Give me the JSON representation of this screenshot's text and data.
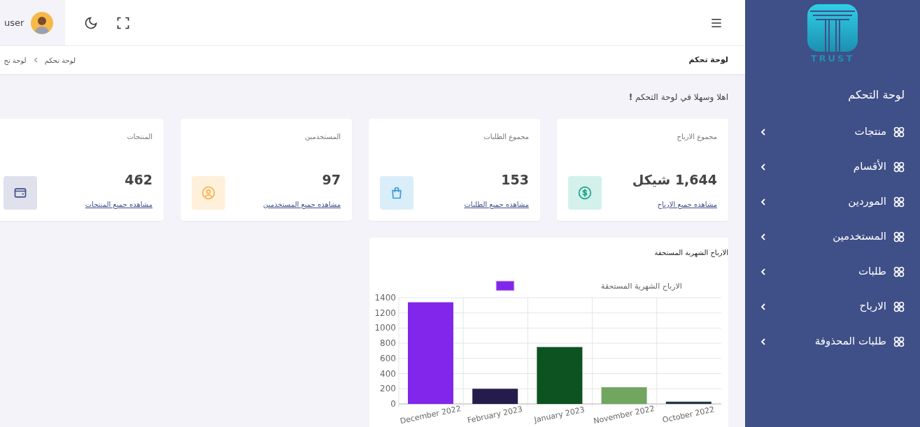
{
  "header": {
    "user_name": "user"
  },
  "breadcrumb": {
    "page_title": "لوحة تحكم",
    "trail": [
      "لوحة تحكم",
      "لوحة تح"
    ]
  },
  "welcome": "اهلا وسهلا في لوحة التحكم **!**",
  "cards": [
    {
      "kind": "money",
      "title": "مجموع الارباح",
      "value": "1,644 شيكل",
      "link": "مشاهده جميع الارباح"
    },
    {
      "kind": "bag",
      "title": "مجموع الطلبات",
      "value": "153",
      "link": "مشاهده جميع الطلبات"
    },
    {
      "kind": "user",
      "title": "المستخدمين",
      "value": "97",
      "link": "مشاهده جميع المستخدمين"
    },
    {
      "kind": "wallet",
      "title": "المنتجات",
      "value": "462",
      "link": "مشاهده جميع المنتجات"
    }
  ],
  "chart_card": {
    "title": "الارباح الشهرية المستحقة",
    "chart_data": {
      "type": "bar",
      "categories": [
        "December 2022",
        "February 2023",
        "January 2023",
        "November 2022",
        "October 2022"
      ],
      "series": [
        {
          "name": "الارباح الشهرية المستحقة",
          "color": "#8226ec",
          "colors": [
            "#8226ec",
            "#261c4c",
            "#0d5221",
            "#71a660",
            "#1f3a4a"
          ],
          "values": [
            1340,
            200,
            750,
            220,
            30
          ]
        }
      ],
      "ylim": [
        0,
        1400
      ],
      "grid": true,
      "yticks": [
        0,
        200,
        400,
        600,
        800,
        1000,
        1200,
        1400
      ]
    }
  },
  "sidebar": {
    "logo_text": "TRUST",
    "heading": "لوحة التحكم",
    "items": [
      {
        "label": "منتجات"
      },
      {
        "label": "الأقسام"
      },
      {
        "label": "الموردين"
      },
      {
        "label": "المستخدمين"
      },
      {
        "label": "طلبات"
      },
      {
        "label": "الارباح"
      },
      {
        "label": "طلبات المحذوفة"
      }
    ]
  }
}
